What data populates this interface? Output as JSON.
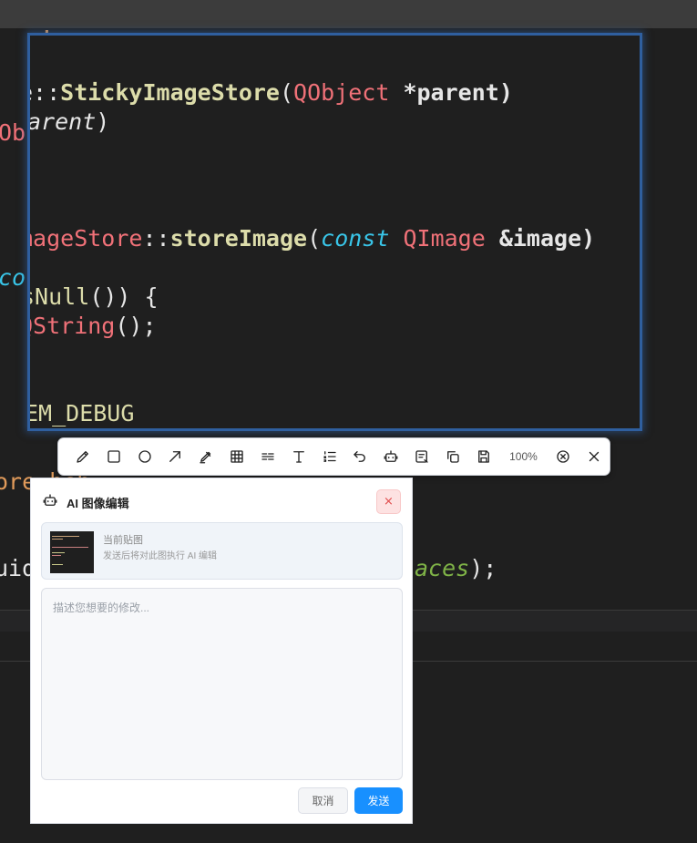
{
  "editor_background": {
    "lines": {
      "l1": "s’",
      "l2_prefix": "e::",
      "l2_fn": "StickyImageStore",
      "l2_paren": "(",
      "l2_type": "QObject",
      "l2_rest": " *parent)",
      "l3_obj": "Obj",
      "l3_param": "arent",
      "l3_close": ")",
      "l4_type": "mageStore",
      "l4_sep": "::",
      "l4_fn": "storeImage",
      "l4_paren": "(",
      "l4_kw": "const",
      "l4_type2": " QImage",
      "l4_rest": " &image)",
      "l5_co": "co",
      "l5_fn": "sNull",
      "l5_rest": "()) {",
      "l6_type": "QString",
      "l6_rest": "();",
      "l7": "EM_DEBUG",
      "l8": "ore beh...::",
      "l9_prefix": "uid",
      "l9_green": "aces",
      "l9_rest": ");"
    }
  },
  "toolbar": {
    "tools": [
      {
        "name": "pencil-icon"
      },
      {
        "name": "rectangle-icon"
      },
      {
        "name": "circle-icon"
      },
      {
        "name": "arrow-icon"
      },
      {
        "name": "marker-icon"
      },
      {
        "name": "mosaic-icon"
      },
      {
        "name": "list-icon"
      },
      {
        "name": "text-icon"
      },
      {
        "name": "numbered-list-icon"
      },
      {
        "name": "undo-icon"
      },
      {
        "name": "robot-icon"
      },
      {
        "name": "ocr-icon"
      },
      {
        "name": "copy-icon"
      },
      {
        "name": "save-icon"
      }
    ],
    "zoom": "100%",
    "end_tools": [
      {
        "name": "circle-close-icon"
      },
      {
        "name": "close-icon"
      }
    ]
  },
  "ai_dialog": {
    "title": "AI 图像编辑",
    "close_glyph": "×",
    "image_card": {
      "title": "当前贴图",
      "subtitle": "发送后将对此图执行 AI 编辑"
    },
    "prompt_placeholder": "描述您想要的修改...",
    "prompt_value": "",
    "cancel_label": "取消",
    "send_label": "发送"
  },
  "colors": {
    "accent": "#1890ff",
    "frame_border": "#2f5f9f",
    "close_bg": "#fde2e2"
  }
}
